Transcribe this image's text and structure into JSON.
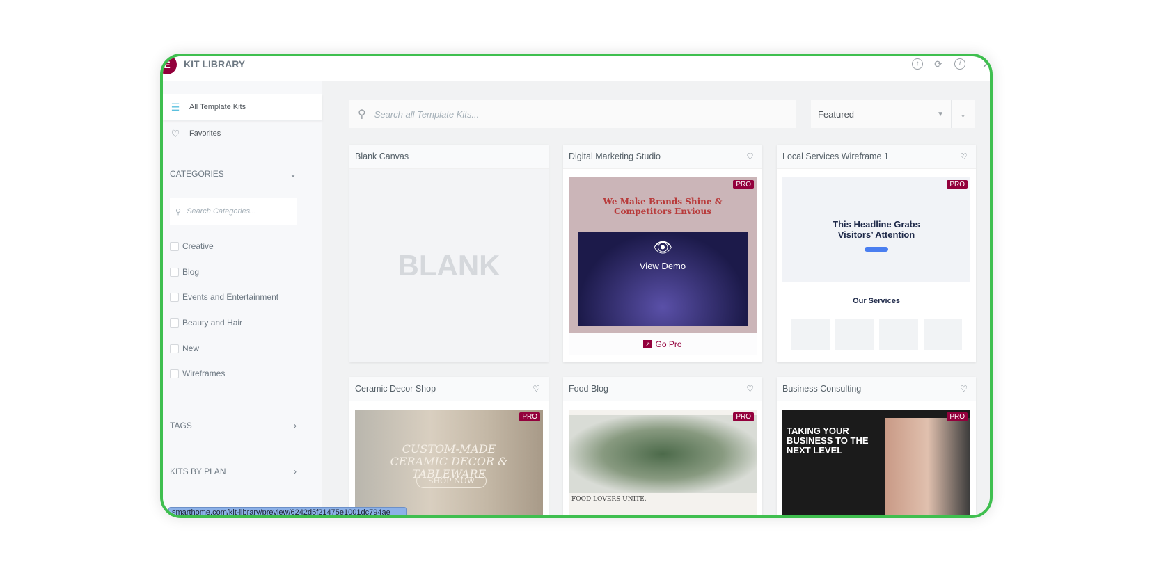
{
  "header": {
    "title": "KIT LIBRARY",
    "icons": [
      "upload-icon",
      "sync-icon",
      "info-icon",
      "close-icon"
    ]
  },
  "sidebar": {
    "nav": [
      {
        "label": "All Template Kits",
        "icon": "filter-icon",
        "active": true
      },
      {
        "label": "Favorites",
        "icon": "heart-icon"
      }
    ],
    "categories": {
      "title": "CATEGORIES",
      "search_placeholder": "Search Categories...",
      "items": [
        "Creative",
        "Blog",
        "Events and Entertainment",
        "Beauty and Hair",
        "New",
        "Wireframes"
      ]
    },
    "tags": {
      "title": "TAGS"
    },
    "plan": {
      "title": "KITS BY PLAN"
    }
  },
  "toolbar": {
    "search_placeholder": "Search all Template Kits...",
    "sort_value": "Featured"
  },
  "cards": [
    {
      "title": "Blank Canvas",
      "preview_text": "BLANK"
    },
    {
      "title": "Digital Marketing Studio",
      "badge": "PRO",
      "preview_headline": "We Make Brands Shine & Competitors Envious",
      "overlay": "View Demo",
      "cta": "Go Pro"
    },
    {
      "title": "Local Services Wireframe 1",
      "badge": "PRO",
      "preview_headline": "This Headline Grabs Visitors’ Attention",
      "preview_section": "Our Services"
    },
    {
      "title": "Ceramic Decor Shop",
      "badge": "PRO",
      "preview_headline": "CUSTOM-MADE CERAMIC DECOR & TABLEWARE",
      "preview_button": "SHOP NOW"
    },
    {
      "title": "Food Blog",
      "badge": "PRO",
      "preview_caption": "FOOD LOVERS UNITE."
    },
    {
      "title": "Business Consulting",
      "badge": "PRO",
      "preview_headline": "TAKING YOUR BUSINESS TO THE NEXT LEVEL"
    }
  ],
  "status_url": "smarthome.com/kit-library/preview/6242d5f21475e1001dc794ae",
  "colors": {
    "brand": "#92003b",
    "frame": "#3fbf4f",
    "accent": "#5bc0de"
  }
}
